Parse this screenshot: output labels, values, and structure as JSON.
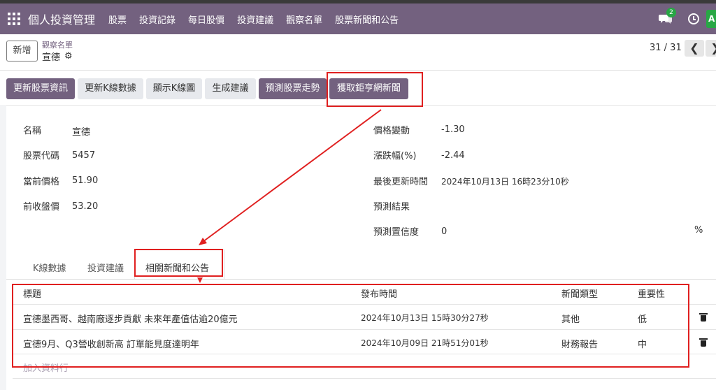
{
  "navbar": {
    "brand": "個人投資管理",
    "menu": [
      "股票",
      "投資記錄",
      "每日股價",
      "投資建議",
      "觀察名單",
      "股票新聞和公告"
    ],
    "badge_count": "2",
    "avatar_letter": "A"
  },
  "control": {
    "new_label": "新增",
    "breadcrumb_parent": "觀察名單",
    "breadcrumb_current": "宣德",
    "pager": "31 / 31",
    "prev_glyph": "❮",
    "next_glyph": "❯"
  },
  "actions": [
    "更新股票資訊",
    "更新K線數據",
    "顯示K線圖",
    "生成建議",
    "預測股票走勢",
    "獲取鉅亨網新聞"
  ],
  "fields_left": [
    {
      "label": "名稱",
      "value": "宣德"
    },
    {
      "label": "股票代碼",
      "value": "5457"
    },
    {
      "label": "當前價格",
      "value": "51.90"
    },
    {
      "label": "前收盤價",
      "value": "53.20"
    }
  ],
  "fields_right": [
    {
      "label": "價格變動",
      "value": "-1.30"
    },
    {
      "label": "漲跌幅(%)",
      "value": "-2.44"
    },
    {
      "label": "最後更新時間",
      "value": "2024年10月13日 16時23分10秒"
    },
    {
      "label": "預測結果",
      "value": ""
    },
    {
      "label": "預測置信度",
      "value": "0",
      "unit": "%"
    }
  ],
  "tabs": [
    "K線數據",
    "投資建議",
    "相關新聞和公告"
  ],
  "news_table": {
    "headers": [
      "標題",
      "發布時間",
      "新聞類型",
      "重要性"
    ],
    "rows": [
      [
        "宣德墨西哥、越南廠逐步貢獻 未來年產值估逾20億元",
        "2024年10月13日 15時30分27秒",
        "其他",
        "低"
      ],
      [
        "宣德9月、Q3營收創新高 訂單能見度達明年",
        "2024年10月09日 21時51分01秒",
        "財務報告",
        "中"
      ]
    ],
    "add_line": "加入資料行"
  },
  "colors": {
    "brand": "#73617f",
    "highlight": "#e02020",
    "badge": "#28a745"
  }
}
